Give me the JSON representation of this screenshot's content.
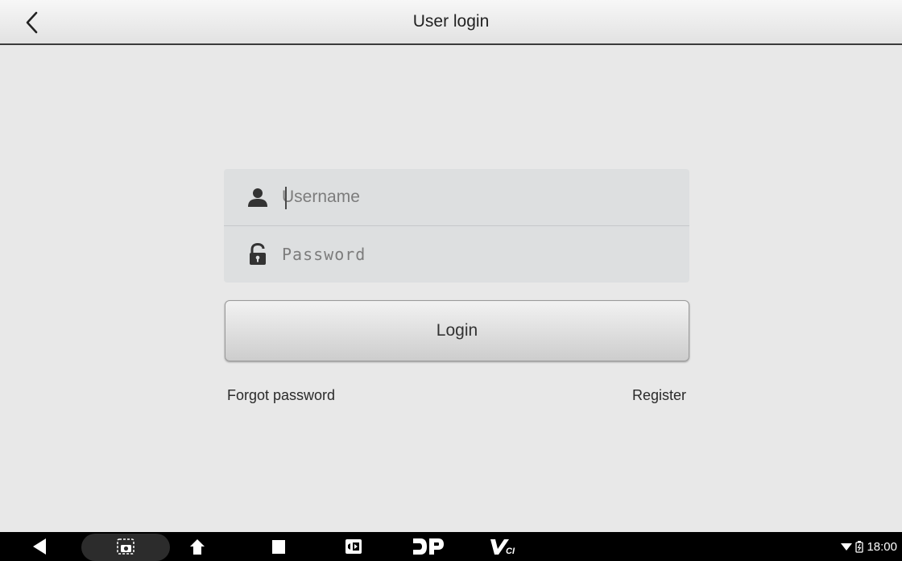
{
  "header": {
    "title": "User login",
    "back_icon": "chevron-left-icon"
  },
  "form": {
    "username": {
      "value": "",
      "placeholder": "Username",
      "icon": "user-icon"
    },
    "password": {
      "value": "",
      "placeholder": "Password",
      "icon": "lock-icon"
    },
    "login_label": "Login",
    "forgot_label": "Forgot password",
    "register_label": "Register"
  },
  "navbar": {
    "items": [
      "back-triangle-icon",
      "screenshot-icon",
      "home-icon",
      "recents-icon",
      "screen-record-icon",
      "dp-app-icon",
      "vci-app-icon"
    ],
    "dp_label": "DP",
    "vci_label": "VCI",
    "time": "18:00"
  },
  "colors": {
    "background": "#e8e8e8",
    "field_bg": "#dddfe0",
    "navbar": "#000000"
  }
}
